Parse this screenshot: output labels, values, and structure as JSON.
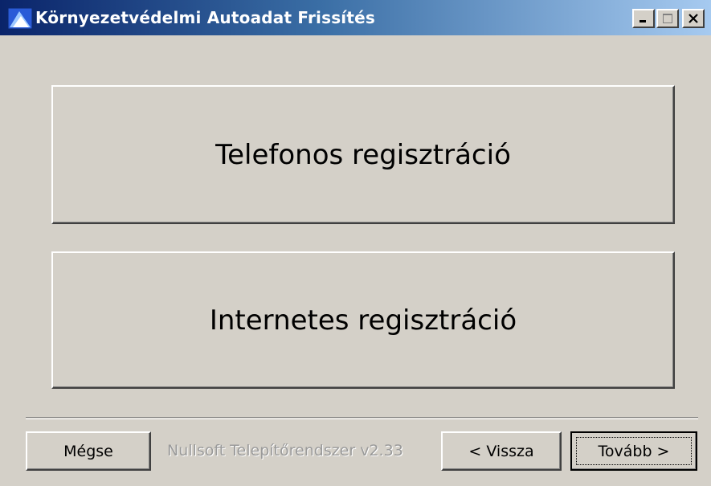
{
  "window": {
    "title": "Környezetvédelmi Autoadat Frissítés",
    "icon": "installer-icon",
    "titlebar_colors": [
      "#0a246a",
      "#a6caf0"
    ]
  },
  "options": {
    "phone_label": "Telefonos regisztráció",
    "internet_label": "Internetes regisztráció"
  },
  "footer": {
    "cancel_label": "Mégse",
    "branding": "Nullsoft Telepítőrendszer v2.33",
    "back_label": "< Vissza",
    "next_label": "Tovább >"
  }
}
